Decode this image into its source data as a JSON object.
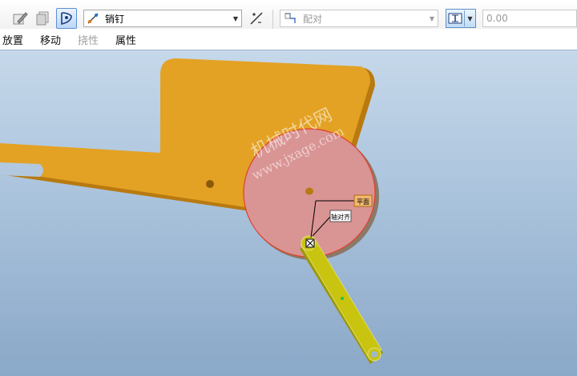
{
  "toolbar": {
    "connection_type": {
      "label": "销钉",
      "icon": "pin-connection-icon"
    },
    "constraint_type": {
      "label": "配对",
      "icon": "mate-constraint-icon"
    },
    "offset_value": "0.00",
    "icons": [
      "edit-definition-icon",
      "copy-icon",
      "placement-pin-icon",
      "flip-icon",
      "coincident-icon"
    ]
  },
  "tabs": [
    {
      "label": "放置",
      "disabled": false
    },
    {
      "label": "移动",
      "disabled": false
    },
    {
      "label": "挠性",
      "disabled": true
    },
    {
      "label": "属性",
      "disabled": false
    }
  ],
  "viewport": {
    "watermark": {
      "line1": "机械时代网",
      "line2": "www.jxage.com"
    },
    "labels": {
      "plane": "平面",
      "axis": "轴对齐"
    },
    "colors": {
      "base_part": "#e3a224",
      "disk_highlight": "#d99494",
      "link_part": "#c8c410",
      "highlight_edge": "#e0402a"
    }
  }
}
